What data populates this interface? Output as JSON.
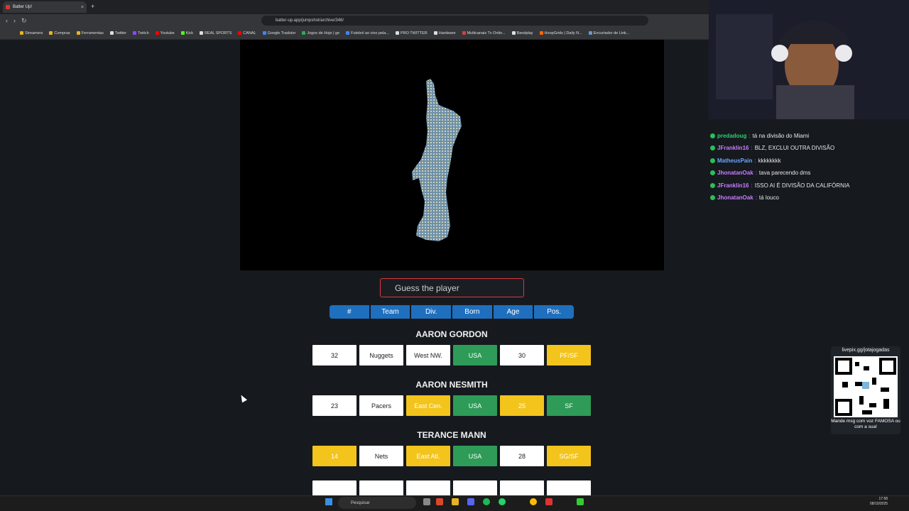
{
  "browser": {
    "tab_title": "Batter Up!",
    "new_tab": "+",
    "close": "×",
    "url": "batter-up.app/jumpshot/archive/346/",
    "bookmarks": [
      "Streamers",
      "Compras",
      "Ferramentas",
      "Twitter",
      "Twitch",
      "Youtube",
      "Kick",
      "REAL SPORTS",
      "CANAL",
      "Google Tradutor",
      "Jogos de Hoje | ge",
      "Futebol ao vivo pela...",
      "PRO TWITTER",
      "Hardware",
      "Multicanais Tv Onlin...",
      "Bandplay",
      "HoopGrids | Daily N...",
      "Encurtador de Link..."
    ]
  },
  "game": {
    "input_placeholder": "Guess the player",
    "headers": [
      "#",
      "Team",
      "Div.",
      "Born",
      "Age",
      "Pos."
    ],
    "guesses": [
      {
        "name": "AARON GORDON",
        "cells": [
          {
            "v": "32",
            "c": "white"
          },
          {
            "v": "Nuggets",
            "c": "white"
          },
          {
            "v": "West NW.",
            "c": "white"
          },
          {
            "v": "USA",
            "c": "green"
          },
          {
            "v": "30",
            "c": "white"
          },
          {
            "v": "PF/SF",
            "c": "yellow"
          }
        ]
      },
      {
        "name": "AARON NESMITH",
        "cells": [
          {
            "v": "23",
            "c": "white"
          },
          {
            "v": "Pacers",
            "c": "white"
          },
          {
            "v": "East Cen.",
            "c": "yellow"
          },
          {
            "v": "USA",
            "c": "green"
          },
          {
            "v": "25",
            "c": "yellow"
          },
          {
            "v": "SF",
            "c": "green"
          }
        ]
      },
      {
        "name": "TERANCE MANN",
        "cells": [
          {
            "v": "14",
            "c": "yellow"
          },
          {
            "v": "Nets",
            "c": "white"
          },
          {
            "v": "East Atl.",
            "c": "yellow"
          },
          {
            "v": "USA",
            "c": "green"
          },
          {
            "v": "28",
            "c": "white"
          },
          {
            "v": "SG/SF",
            "c": "yellow"
          }
        ]
      }
    ]
  },
  "chat": [
    {
      "user": "predadoug",
      "color": "#2bd16a",
      "text": "tá na divisão do Miami"
    },
    {
      "user": "JFranklin16",
      "color": "#c77dff",
      "text": "BLZ, EXCLUI OUTRA DIVISÃO"
    },
    {
      "user": "MatheusPain",
      "color": "#6aa5ff",
      "text": "kkkkkkkk"
    },
    {
      "user": "JhonatanOak",
      "color": "#c77dff",
      "text": "tava parecendo dms"
    },
    {
      "user": "JFranklin16",
      "color": "#c77dff",
      "text": "ISSO AI É DIVISÃO DA CALIFÓRNIA"
    },
    {
      "user": "JhonatanOak",
      "color": "#c77dff",
      "text": "tá louco"
    }
  ],
  "overlay": {
    "qr_top": "livepix.gg/jotajogadas",
    "qr_caption": "Mande msg com voz FAMOSA ou com a sua!"
  },
  "taskbar": {
    "search": "Pesquisar",
    "time": "17:58",
    "date": "08/10/2025"
  }
}
